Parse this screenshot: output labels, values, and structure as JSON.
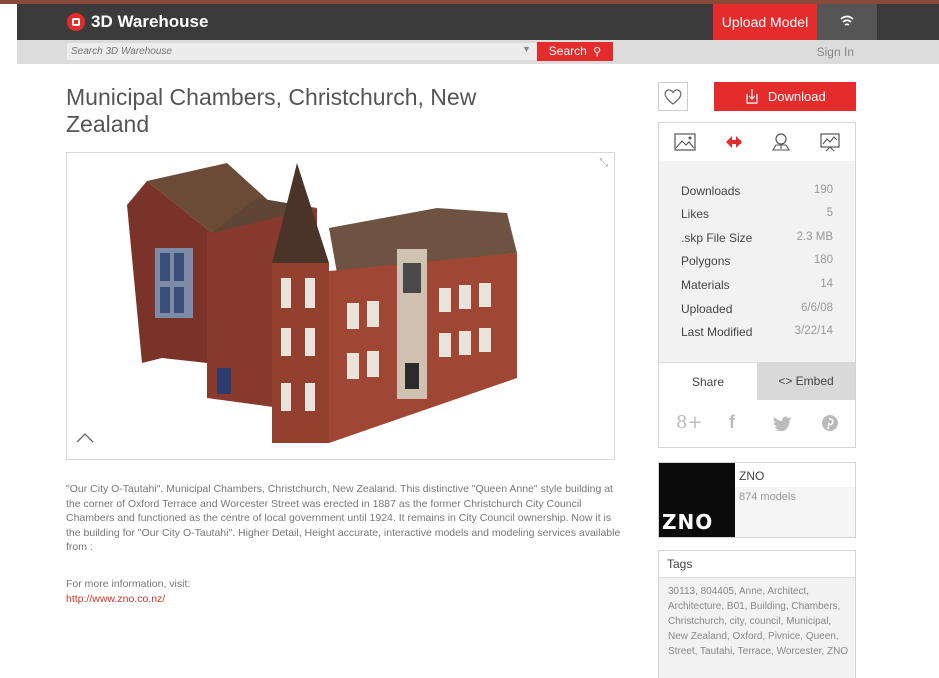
{
  "header": {
    "logo_text": "3D Warehouse",
    "upload_label": "Upload Model",
    "menu_icon": "wifi-menu-icon",
    "search_placeholder": "Search 3D Warehouse",
    "search_label": "Search",
    "signin_label": "Sign In",
    "accent_color": "#e42c2c"
  },
  "model": {
    "title": "Municipal Chambers, Christchurch, New Zealand",
    "description": "\"Our City O-Tautahi\". Municipal Chambers, Christchurch, New Zealand. This distinctive \"Queen Anne\" style building at the corner of Oxford Terrace and Worcester Street was erected in 1887 as the former Christchurch City Council Chambers and functioned as the centre of local government until 1924. It remains in City Council ownership. Now it is the building for \"Our City O-Tautahi\". Higher Detail, Height accurate, interactive models and modeling services available from :",
    "more_info": "For more information, visit:",
    "link": "http://www.zno.co.nz/"
  },
  "actions": {
    "download_label": "Download"
  },
  "stats": [
    {
      "label": "Downloads",
      "value": "190"
    },
    {
      "label": "Likes",
      "value": "5"
    },
    {
      "label": ".skp File Size",
      "value": "2.3 MB"
    },
    {
      "label": "Polygons",
      "value": "180"
    },
    {
      "label": "Materials",
      "value": "14"
    },
    {
      "label": "Uploaded",
      "value": "6/6/08"
    },
    {
      "label": "Last Modified",
      "value": "3/22/14"
    }
  ],
  "tabs": {
    "share": "Share",
    "embed": "<> Embed"
  },
  "social": {
    "gplus": "8+",
    "facebook": "f"
  },
  "author": {
    "avatar_text": "ZNO",
    "name": "ZNO",
    "models": "874 models"
  },
  "tags": {
    "title": "Tags",
    "list": "30113, 804405, Anne, Architect, Architecture, B01, Building, Chambers, Christchurch, city, council, Municipal, New Zealand, Oxford, Pivnice, Queen, Street, Tautahi, Terrace, Worcester, ZNO"
  }
}
